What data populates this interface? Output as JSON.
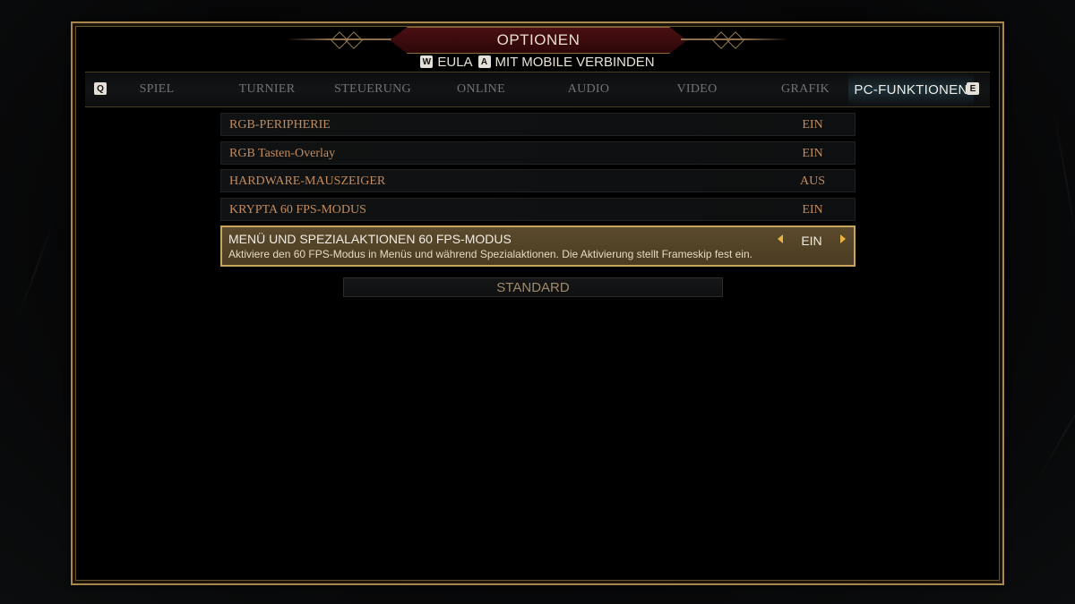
{
  "header": {
    "title": "OPTIONEN",
    "links": [
      {
        "key": "W",
        "label": "EULA"
      },
      {
        "key": "A",
        "label": "MIT MOBILE VERBINDEN"
      }
    ]
  },
  "tabs": {
    "prev_key": "Q",
    "next_key": "E",
    "items": [
      {
        "label": "SPIEL"
      },
      {
        "label": "TURNIER"
      },
      {
        "label": "STEUERUNG"
      },
      {
        "label": "ONLINE"
      },
      {
        "label": "AUDIO"
      },
      {
        "label": "VIDEO"
      },
      {
        "label": "GRAFIK"
      },
      {
        "label": "PC-FUNKTIONEN"
      }
    ],
    "active": "PC-FUNKTIONEN"
  },
  "settings": [
    {
      "label": "RGB-PERIPHERIE",
      "value": "EIN"
    },
    {
      "label": "RGB Tasten-Overlay",
      "value": "EIN"
    },
    {
      "label": "HARDWARE-MAUSZEIGER",
      "value": "AUS"
    },
    {
      "label": "KRYPTA 60 FPS-MODUS",
      "value": "EIN"
    },
    {
      "label": "MENÜ UND SPEZIALAKTIONEN 60 FPS-MODUS",
      "value": "EIN",
      "description": "Aktiviere den 60 FPS-Modus in Menüs und während Spezialaktionen. Die Aktivierung stellt Frameskip fest ein."
    }
  ],
  "standard_button": "STANDARD",
  "colors": {
    "accent_gold": "#c9a45c",
    "label_orange": "#c28c5e",
    "title_red": "#4a0f12",
    "arrow_yellow": "#e8b340"
  },
  "icons": [
    "chevron-left-icon",
    "chevron-right-icon"
  ]
}
